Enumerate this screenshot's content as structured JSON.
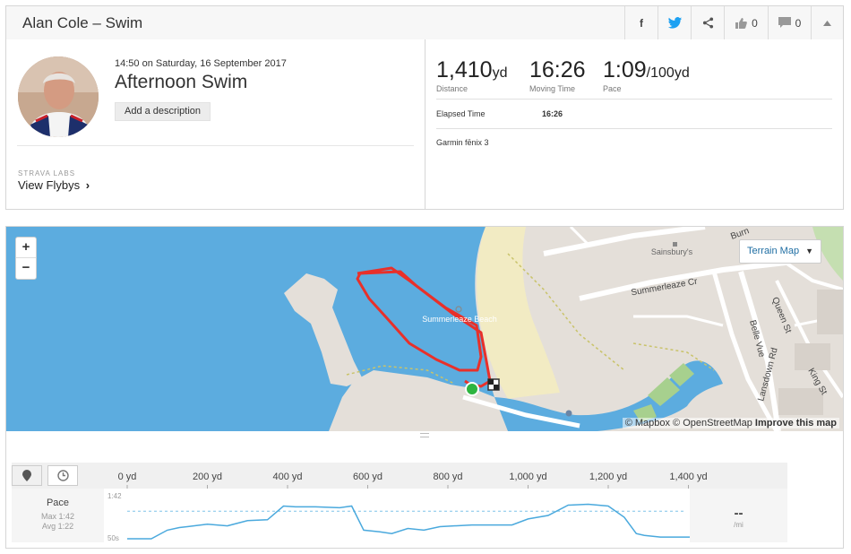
{
  "header": {
    "title": "Alan Cole – Swim",
    "kudos_count": "0",
    "comment_count": "0"
  },
  "activity": {
    "datetime": "14:50 on Saturday, 16 September 2017",
    "name": "Afternoon Swim",
    "add_description": "Add a description",
    "labs_label": "STRAVA LABS",
    "view_flybys": "View Flybys"
  },
  "stats": {
    "distance": {
      "value": "1,410",
      "unit": "yd",
      "label": "Distance"
    },
    "moving_time": {
      "value": "16:26",
      "label": "Moving Time"
    },
    "pace": {
      "value": "1:09",
      "unit": "/100yd",
      "label": "Pace"
    },
    "elapsed_label": "Elapsed Time",
    "elapsed_value": "16:26",
    "device": "Garmin fēnix 3"
  },
  "map": {
    "zoom_in": "+",
    "zoom_out": "−",
    "terrain_label": "Terrain Map",
    "attribution": "© Mapbox © OpenStreetMap",
    "improve": "Improve this map",
    "labels": {
      "beach": "Summerleaze Beach",
      "sainsbury": "Sainsbury's",
      "summerleaze_cr": "Summerleaze Cr",
      "belle_vue": "Belle Vue",
      "queen_st": "Queen St",
      "lansdown_rd": "Lansdown Rd",
      "king_st": "King St",
      "burn": "Burn"
    }
  },
  "chart": {
    "pace_label": "Pace",
    "max": "Max 1:42",
    "avg": "Avg 1:22",
    "current_value": "--",
    "current_unit": "/mi",
    "y_top": "1:42",
    "y_bottom": "50s"
  },
  "chart_data": {
    "type": "area",
    "title": "",
    "xlabel": "",
    "ylabel": "Pace",
    "x_ticks": [
      "0 yd",
      "200 yd",
      "400 yd",
      "600 yd",
      "800 yd",
      "1,000 yd",
      "1,200 yd",
      "1,400 yd"
    ],
    "xlim": [
      0,
      1410
    ],
    "ylim_seconds": [
      50,
      102
    ],
    "average_seconds": 82,
    "series": [
      {
        "x": [
          0,
          60,
          100,
          130,
          150,
          200,
          250,
          300,
          350,
          390,
          420,
          470,
          530,
          560,
          590,
          630,
          660,
          700,
          740,
          780,
          860,
          960,
          1000,
          1050,
          1100,
          1150,
          1200,
          1240,
          1270,
          1290,
          1330,
          1410
        ],
        "y_seconds": [
          50,
          50,
          60,
          63,
          64,
          67,
          65,
          71,
          72,
          88,
          87,
          87,
          86,
          88,
          60,
          58,
          56,
          62,
          60,
          64,
          66,
          66,
          73,
          77,
          89,
          90,
          88,
          75,
          56,
          54,
          52,
          52
        ]
      }
    ],
    "grid": false,
    "legend": "none"
  }
}
